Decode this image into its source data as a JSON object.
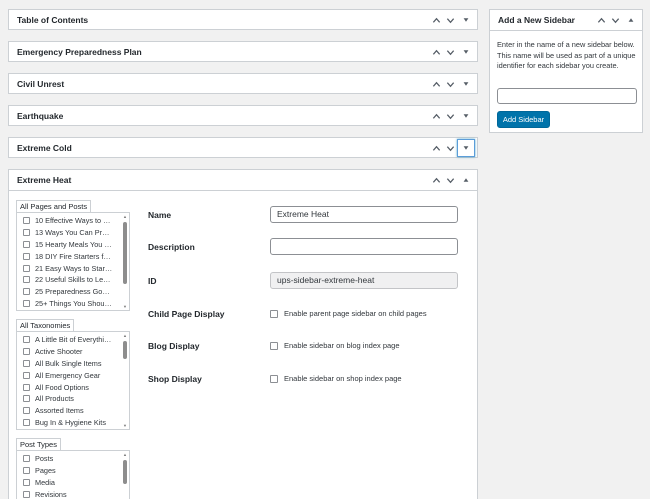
{
  "panels": [
    {
      "title": "Table of Contents"
    },
    {
      "title": "Emergency Preparedness Plan"
    },
    {
      "title": "Civil Unrest"
    },
    {
      "title": "Earthquake"
    },
    {
      "title": "Extreme Cold"
    }
  ],
  "active_panel": {
    "title": "Extreme Heat",
    "listboxes": [
      {
        "label": "All Pages and Posts",
        "items": [
          "10 Effective Ways to …",
          "13 Ways You Can Pre…",
          "15 Hearty Meals You …",
          "18 DIY Fire Starters fo…",
          "21 Easy Ways to Start…",
          "22 Useful Skills to Le…",
          "25 Preparedness Goa…",
          "25+ Things You Shoul…"
        ]
      },
      {
        "label": "All Taxonomies",
        "items": [
          "A Little Bit of Everythi…",
          "Active Shooter",
          "All Bulk Single Items",
          "All Emergency Gear",
          "All Food Options",
          "All Products",
          "Assorted Items",
          "Bug In & Hygiene Kits"
        ]
      },
      {
        "label": "Post Types",
        "items": [
          "Posts",
          "Pages",
          "Media",
          "Revisions"
        ]
      }
    ],
    "form": {
      "name_label": "Name",
      "name_value": "Extreme Heat",
      "description_label": "Description",
      "description_value": "",
      "id_label": "ID",
      "id_value": "ups-sidebar-extreme-heat",
      "child_page_label": "Child Page Display",
      "child_page_option": "Enable parent page sidebar on child pages",
      "blog_label": "Blog Display",
      "blog_option": "Enable sidebar on blog index page",
      "shop_label": "Shop Display",
      "shop_option": "Enable sidebar on shop index page"
    }
  },
  "sidebar_widget": {
    "title": "Add a New Sidebar",
    "description": "Enter in the name of a new sidebar below. This name will be used as part of a unique identifier for each sidebar you create.",
    "input_value": "",
    "button_label": "Add Sidebar"
  },
  "icons": {
    "up": "chevron-up-icon",
    "down": "chevron-down-icon",
    "toggle_open": "triangle-up-icon",
    "toggle_closed": "triangle-down-icon"
  },
  "colors": {
    "primary_button": "#0073aa",
    "focus_ring": "#5b9dd9",
    "border": "#ccd0d4",
    "background": "#f1f1f1"
  }
}
